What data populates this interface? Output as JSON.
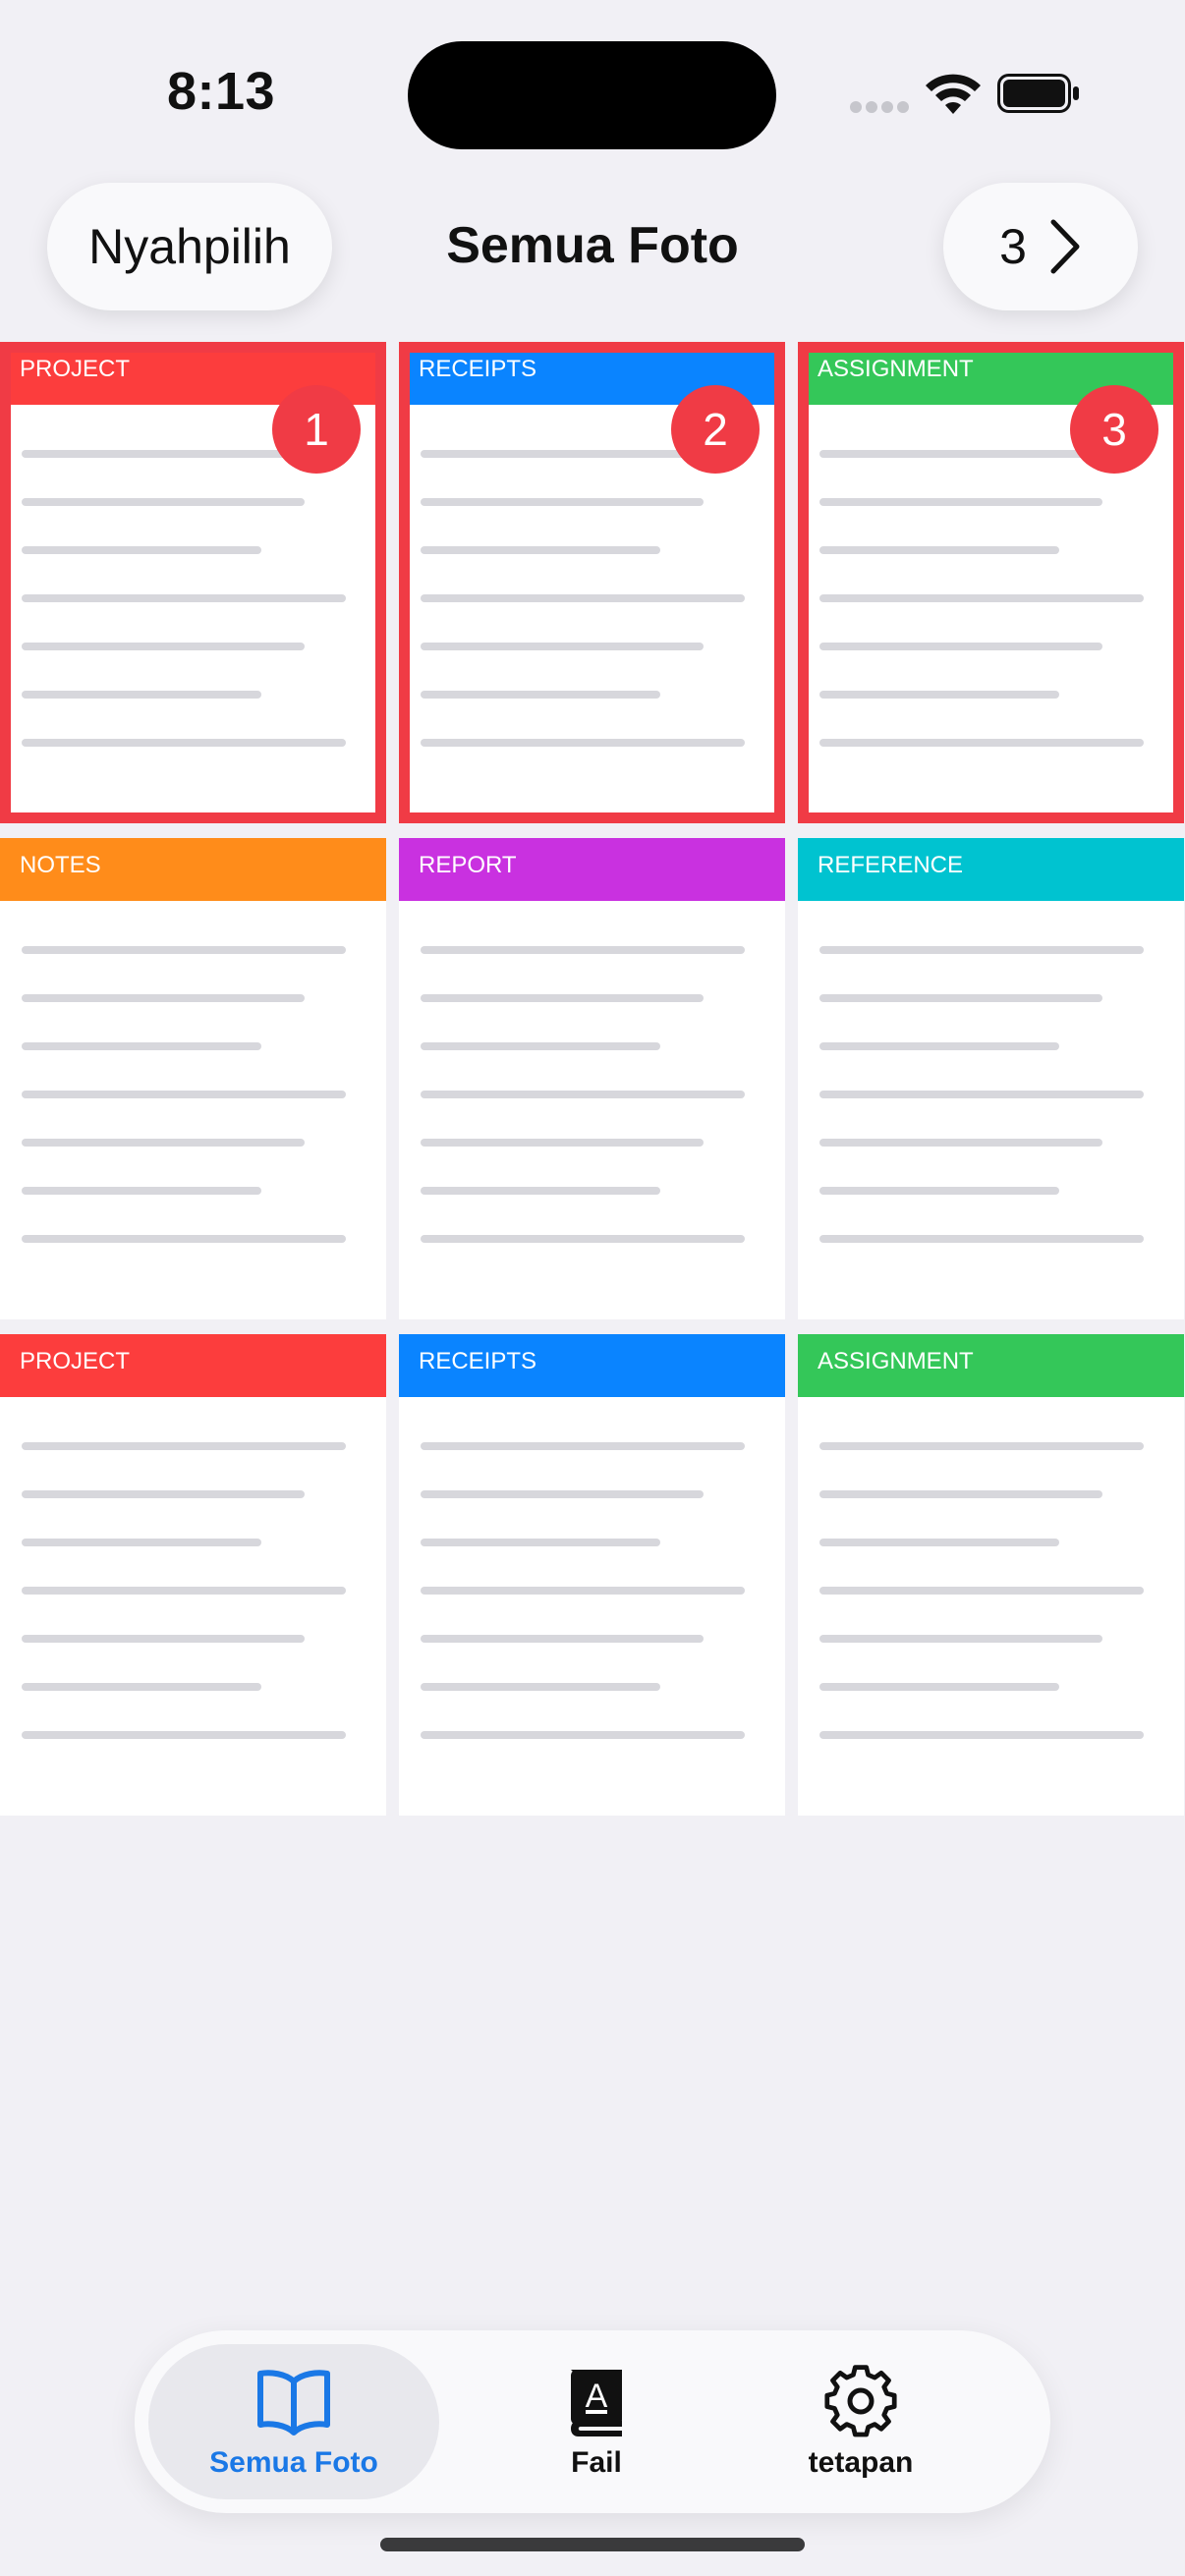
{
  "status": {
    "time": "8:13"
  },
  "nav": {
    "select_label": "Nyahpilih",
    "title": "Semua Foto",
    "selected_count": "3"
  },
  "grid": {
    "cards": [
      {
        "label": "PROJECT",
        "color": "#fc3d3d",
        "selected": true,
        "badge": "1"
      },
      {
        "label": "RECEIPTS",
        "color": "#0a84ff",
        "selected": true,
        "badge": "2"
      },
      {
        "label": "ASSIGNMENT",
        "color": "#34c759",
        "selected": true,
        "badge": "3"
      },
      {
        "label": "NOTES",
        "color": "#ff8c1a",
        "selected": false,
        "badge": ""
      },
      {
        "label": "REPORT",
        "color": "#c931e0",
        "selected": false,
        "badge": ""
      },
      {
        "label": "REFERENCE",
        "color": "#00c3d0",
        "selected": false,
        "badge": ""
      },
      {
        "label": "PROJECT",
        "color": "#fc3d3d",
        "selected": false,
        "badge": ""
      },
      {
        "label": "RECEIPTS",
        "color": "#0a84ff",
        "selected": false,
        "badge": ""
      },
      {
        "label": "ASSIGNMENT",
        "color": "#34c759",
        "selected": false,
        "badge": ""
      }
    ]
  },
  "tabbar": {
    "tabs": [
      {
        "label": "Semua Foto",
        "icon": "book-open-icon",
        "active": true
      },
      {
        "label": "Fail",
        "icon": "dictionary-icon",
        "active": false
      },
      {
        "label": "tetapan",
        "icon": "gear-icon",
        "active": false
      }
    ]
  },
  "colors": {
    "accent": "#1a78e6",
    "selection": "#f03b45"
  }
}
